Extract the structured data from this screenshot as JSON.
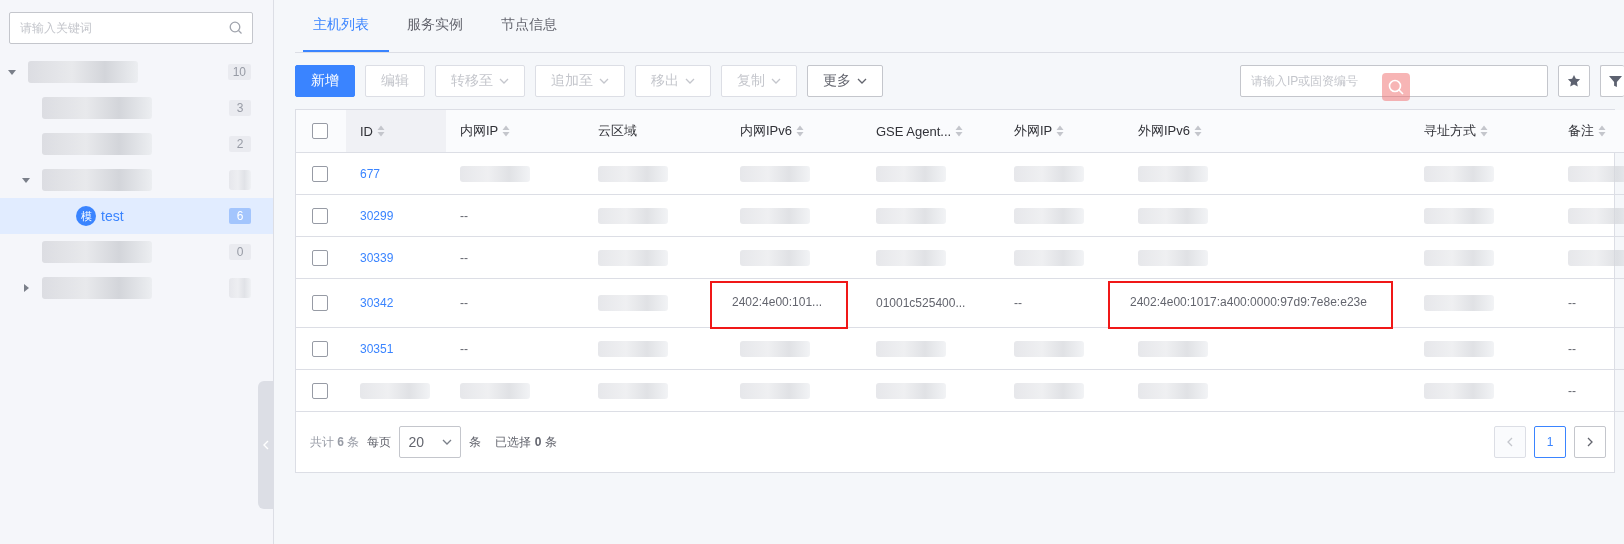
{
  "sidebar": {
    "search": {
      "placeholder": "请输入关键词"
    },
    "tree": [
      {
        "count": "10",
        "expanded": true,
        "selected": false,
        "children": [
          {
            "count": "3",
            "selected": false
          },
          {
            "count": "2",
            "selected": false
          },
          {
            "expanded": true,
            "selected": false,
            "children": [
              {
                "label": "test",
                "badge": "模",
                "count": "6",
                "selected": true
              }
            ]
          },
          {
            "count": "0",
            "selected": false
          },
          {
            "expanded": false,
            "selected": false
          }
        ]
      }
    ]
  },
  "tabs": [
    {
      "label": "主机列表",
      "selected": true
    },
    {
      "label": "服务实例",
      "selected": false
    },
    {
      "label": "节点信息",
      "selected": false
    }
  ],
  "toolbar": {
    "buttons": [
      {
        "label": "新增",
        "kind": "primary",
        "disabled": false,
        "dropdown": false
      },
      {
        "label": "编辑",
        "kind": "plain",
        "disabled": true,
        "dropdown": false
      },
      {
        "label": "转移至",
        "kind": "plain",
        "disabled": true,
        "dropdown": true
      },
      {
        "label": "追加至",
        "kind": "plain",
        "disabled": true,
        "dropdown": true
      },
      {
        "label": "移出",
        "kind": "plain",
        "disabled": true,
        "dropdown": true
      },
      {
        "label": "复制",
        "kind": "plain",
        "disabled": true,
        "dropdown": true
      },
      {
        "label": "更多",
        "kind": "plain",
        "disabled": false,
        "dropdown": true
      }
    ],
    "search": {
      "placeholder": "请输入IP或固资编号"
    }
  },
  "table": {
    "all_selected": false,
    "columns": [
      {
        "label": "ID",
        "sortable": true,
        "kind": "link"
      },
      {
        "label": "内网IP",
        "sortable": true
      },
      {
        "label": "云区域",
        "sortable": false
      },
      {
        "label": "内网IPv6",
        "sortable": true
      },
      {
        "label": "GSE Agent...",
        "sortable": true
      },
      {
        "label": "外网IP",
        "sortable": true
      },
      {
        "label": "外网IPv6",
        "sortable": true
      },
      {
        "label": "寻址方式",
        "sortable": true
      },
      {
        "label": "备注",
        "sortable": true
      }
    ],
    "rows": [
      {
        "selected": false,
        "cells": [
          "677",
          null,
          null,
          null,
          null,
          null,
          null,
          null,
          null
        ]
      },
      {
        "selected": false,
        "cells": [
          "30299",
          "--",
          null,
          null,
          null,
          null,
          null,
          null,
          null
        ]
      },
      {
        "selected": false,
        "cells": [
          "30339",
          "--",
          null,
          null,
          null,
          null,
          null,
          null,
          null
        ]
      },
      {
        "selected": false,
        "cells": [
          "30342",
          "--",
          null,
          {
            "text": "2402:4e00:101...",
            "highlighted": true
          },
          "01001c525400...",
          "--",
          {
            "text": "2402:4e00:1017:a400:0000:97d9:7e8e:e23e",
            "highlighted": true
          },
          null,
          "--"
        ]
      },
      {
        "selected": false,
        "cells": [
          "30351",
          "--",
          null,
          null,
          null,
          null,
          null,
          null,
          "--"
        ]
      },
      {
        "selected": false,
        "cells": [
          null,
          null,
          null,
          null,
          null,
          null,
          null,
          null,
          "--"
        ]
      }
    ]
  },
  "footer": {
    "total": "共计 **6** 条",
    "per_page_label": "每页",
    "per_page": "20",
    "unit": "条",
    "selected": "已选择 **0** 条",
    "pages": [
      {
        "label": "1",
        "selected": true
      }
    ],
    "prev_disabled": true,
    "next_disabled": false
  }
}
